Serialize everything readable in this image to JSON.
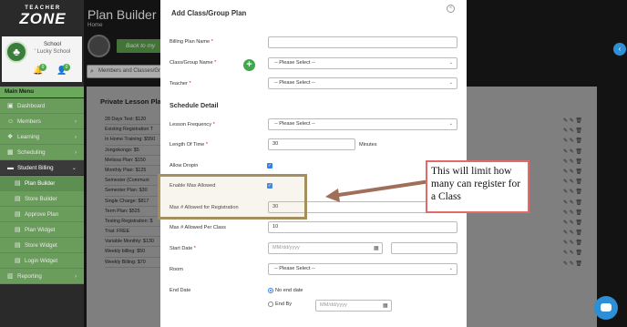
{
  "sidebar": {
    "logo_top": "TEACHER",
    "logo_main": "ZONE",
    "school_label": "School",
    "school_name": "' Lucky School",
    "notifications_count": "0",
    "users_count": "0",
    "main_menu": "Main Menu",
    "items": [
      {
        "label": "Dashboard",
        "icon": "dashboard-icon"
      },
      {
        "label": "Members",
        "icon": "members-icon"
      },
      {
        "label": "Learning",
        "icon": "learning-icon"
      },
      {
        "label": "Scheduling",
        "icon": "scheduling-icon"
      },
      {
        "label": "Student Billing",
        "icon": "billing-icon"
      },
      {
        "label": "Plan Builder",
        "icon": "plan-builder-icon"
      },
      {
        "label": "Store Builder",
        "icon": "store-builder-icon"
      },
      {
        "label": "Approve Plan",
        "icon": "approve-plan-icon"
      },
      {
        "label": "Plan Widget",
        "icon": "plan-widget-icon"
      },
      {
        "label": "Store Widget",
        "icon": "store-widget-icon"
      },
      {
        "label": "Login Widget",
        "icon": "login-widget-icon"
      },
      {
        "label": "Reporting",
        "icon": "reporting-icon"
      }
    ]
  },
  "page": {
    "title": "Plan Builder",
    "breadcrumb": "Home",
    "back_button": "Back to my",
    "search_placeholder": "Members and Classes/Gr",
    "panel_title": "Private Lesson Pla",
    "plans": [
      "28 Days Test: $120",
      "Existing Registration T",
      "In Home Training: $550",
      "Jongokongo: $5",
      "Melissa Plan: $150",
      "Monthly Plan: $125",
      "Semester (Communi",
      "Semester Plan: $30",
      "Single Charge: $817",
      "Term Plan: $525",
      "Testing Registration: $",
      "Trial: FREE",
      "Variable Monthly: $130",
      "Weekly billing: $50",
      "Weekly Billing: $70"
    ],
    "row_actions": "✎ ✎ 🗑"
  },
  "modal": {
    "title": "Add Class/Group Plan",
    "billing_plan_name_label": "Billing Plan Name",
    "billing_plan_name_value": "",
    "class_group_name_label": "Class/Group Name",
    "class_group_name_value": "-- Please Select --",
    "teacher_label": "Teacher",
    "teacher_value": "-- Please Select --",
    "section_heading": "Schedule Detail",
    "lesson_frequency_label": "Lesson Frequency",
    "lesson_frequency_value": "-- Please Select --",
    "length_of_time_label": "Length Of Time",
    "length_of_time_value": "30",
    "length_unit": "Minutes",
    "allow_dropin_label": "Allow Dropin",
    "enable_max_allowed_label": "Enable Max Allowed",
    "max_allowed_registration_label": "Max # Allowed for Registration",
    "max_allowed_registration_value": "30",
    "max_allowed_per_class_label": "Max # Allowed Per Class",
    "max_allowed_per_class_value": "10",
    "start_date_label": "Start Date",
    "start_date_placeholder": "MM/dd/yyyy",
    "room_label": "Room",
    "room_value": "-- Please Select --",
    "end_date_label": "End Date",
    "no_end_date_label": "No end date",
    "end_by_label": "End By",
    "end_by_placeholder": "MM/dd/yyyy"
  },
  "annotation": {
    "callout_text": "This will limit how many can register for a Class"
  },
  "colors": {
    "sidebar_green": "#6a9c5c",
    "accent_blue": "#2d8fd5",
    "callout_border": "#e46a6a",
    "highlight_border": "#a48e5f",
    "arrow": "#a06f5a"
  }
}
